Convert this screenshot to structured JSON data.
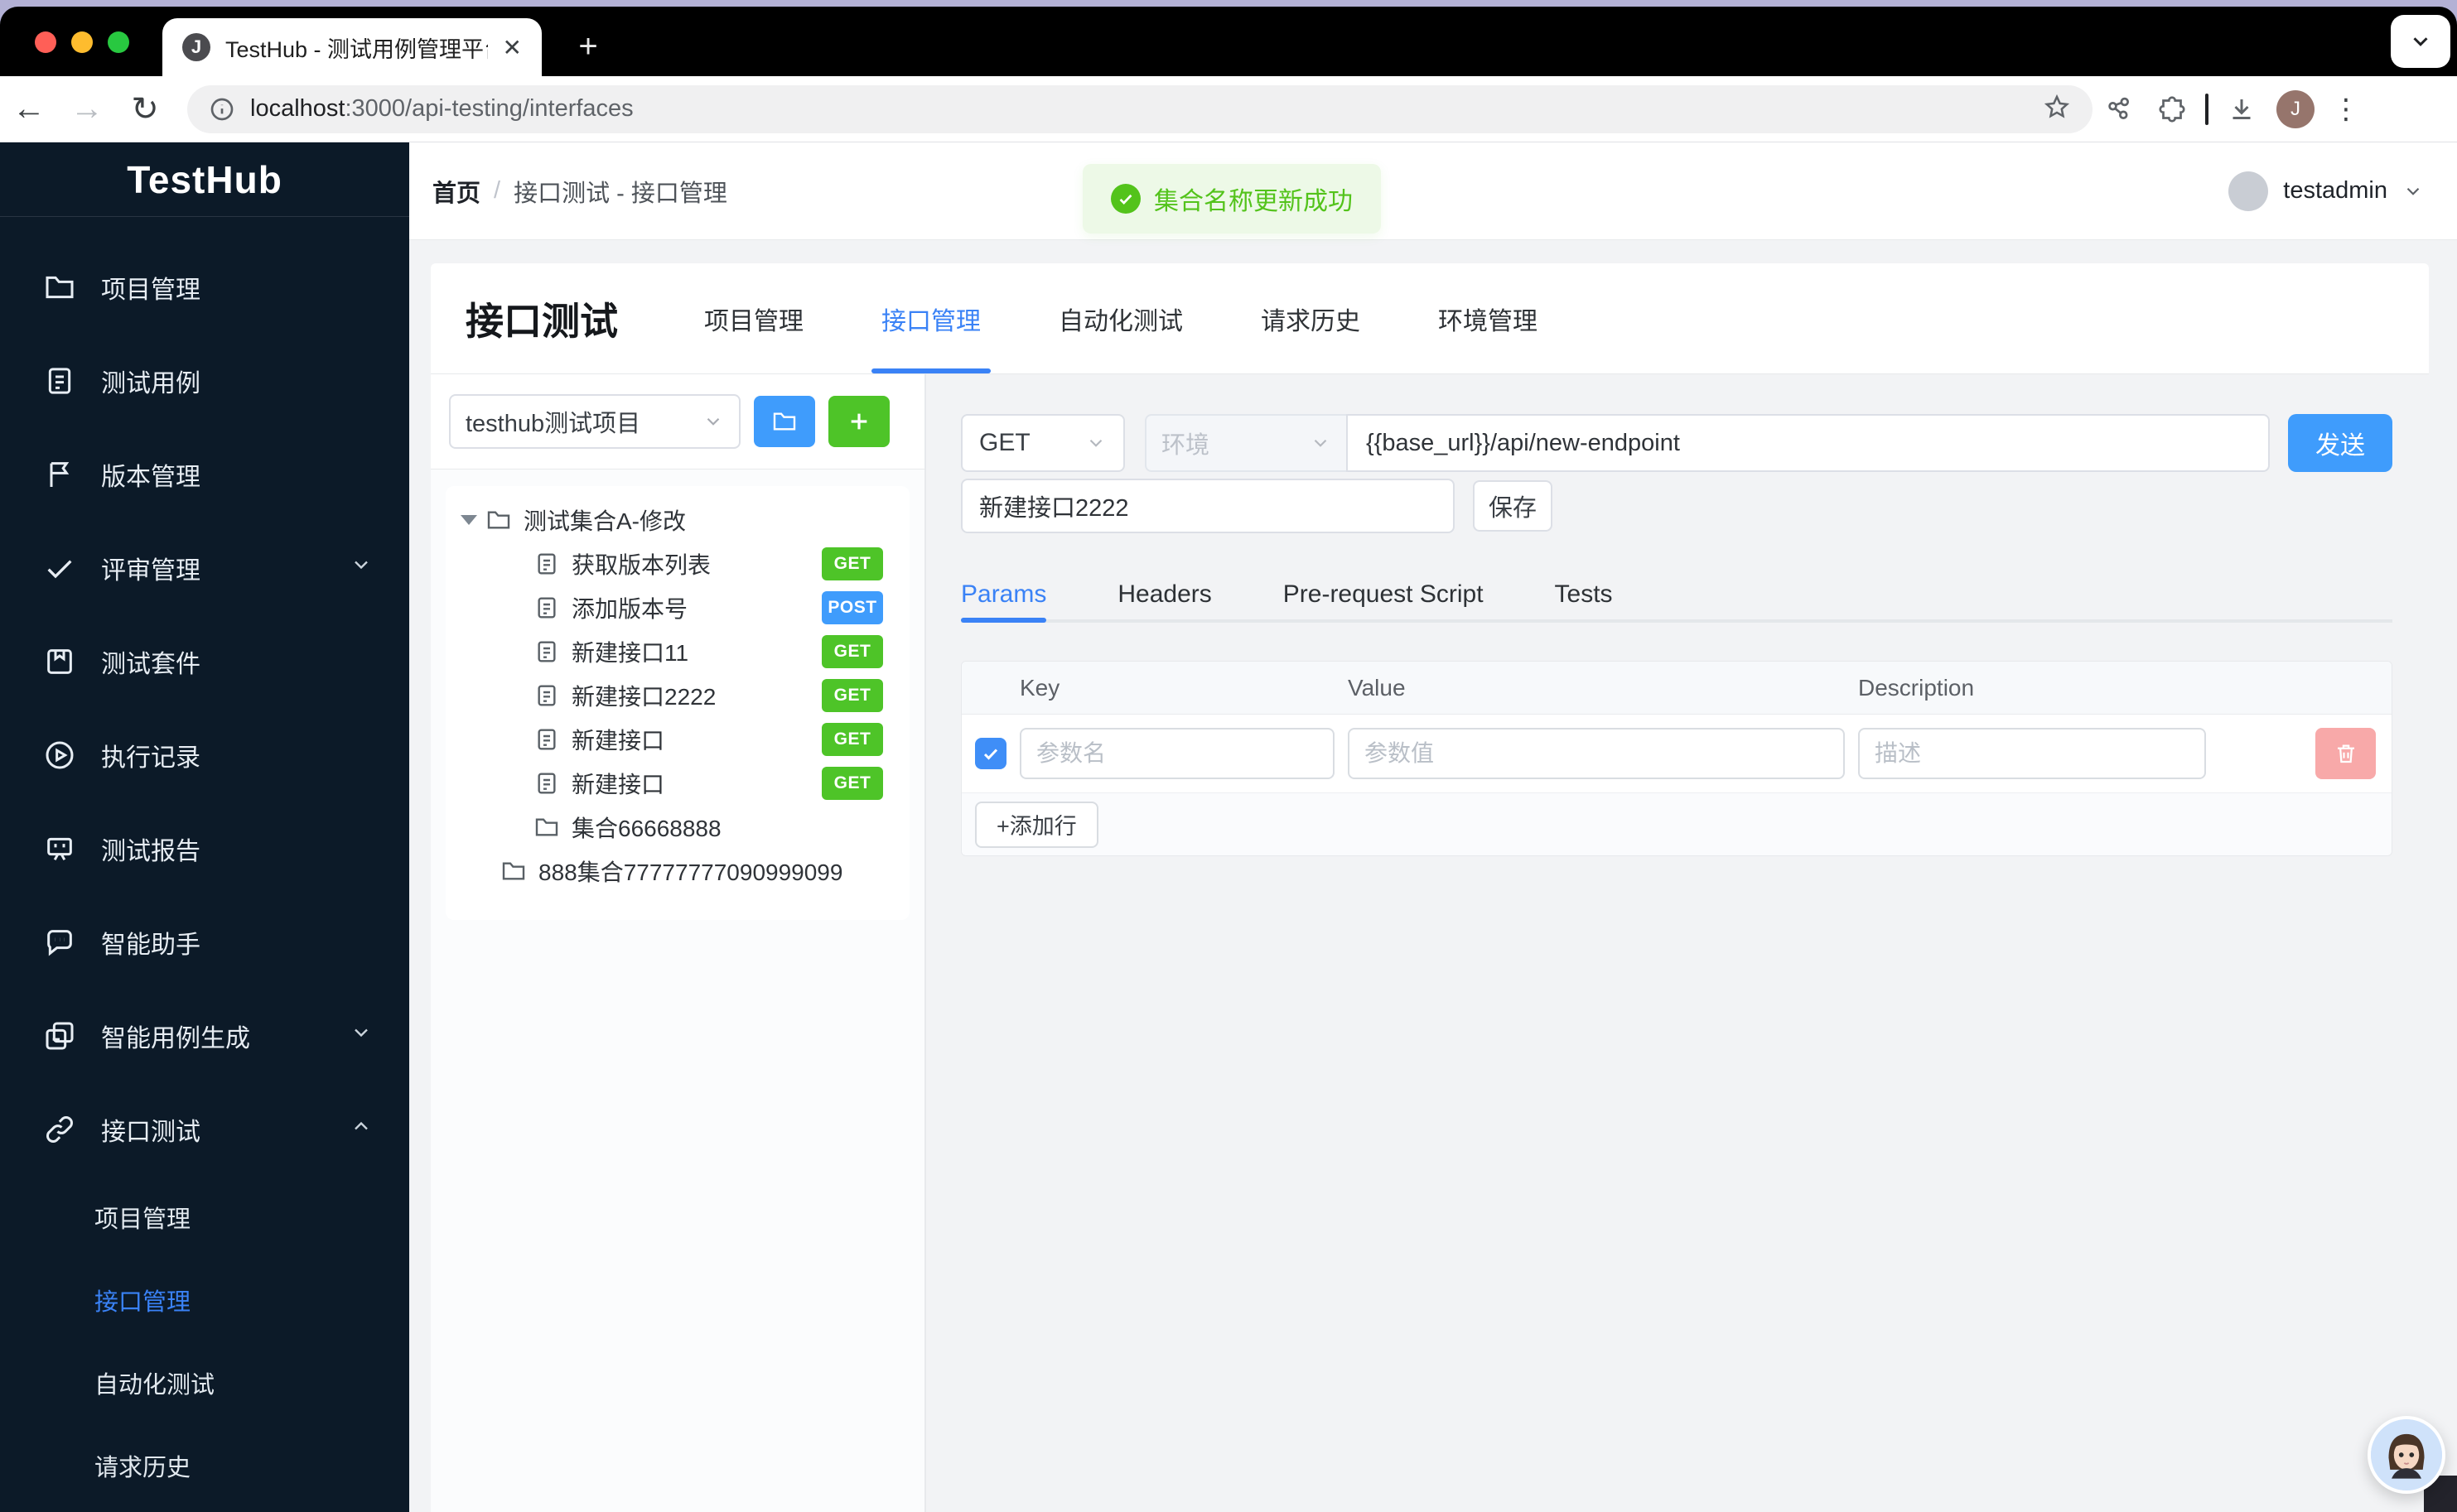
{
  "browser": {
    "tab_title": "TestHub - 测试用例管理平台",
    "url_host": "localhost",
    "url_path": ":3000/api-testing/interfaces",
    "profile_initial": "J"
  },
  "sidebar": {
    "logo": "TestHub",
    "items": [
      {
        "label": "项目管理",
        "icon": "folder"
      },
      {
        "label": "测试用例",
        "icon": "document"
      },
      {
        "label": "版本管理",
        "icon": "flag"
      },
      {
        "label": "评审管理",
        "icon": "check",
        "chevron": "down"
      },
      {
        "label": "测试套件",
        "icon": "suite"
      },
      {
        "label": "执行记录",
        "icon": "play-circle"
      },
      {
        "label": "测试报告",
        "icon": "report-board"
      },
      {
        "label": "智能助手",
        "icon": "chat"
      },
      {
        "label": "智能用例生成",
        "icon": "copy-docs",
        "chevron": "down"
      },
      {
        "label": "接口测试",
        "icon": "link",
        "chevron": "up"
      }
    ],
    "sub_items": [
      {
        "label": "项目管理"
      },
      {
        "label": "接口管理",
        "active": true
      },
      {
        "label": "自动化测试"
      },
      {
        "label": "请求历史"
      }
    ]
  },
  "header": {
    "breadcrumb_home": "首页",
    "breadcrumb_separator": "/",
    "breadcrumb_current": "接口测试 - 接口管理",
    "user_name": "testadmin"
  },
  "toast": {
    "message": "集合名称更新成功"
  },
  "main": {
    "title": "接口测试",
    "tabs": [
      "项目管理",
      "接口管理",
      "自动化测试",
      "请求历史",
      "环境管理"
    ],
    "active_tab": "接口管理"
  },
  "collections": {
    "project_select": "testhub测试项目",
    "tree": {
      "rows": [
        {
          "label": "测试集合A-修改",
          "type": "folder-open"
        },
        {
          "label": "获取版本列表",
          "method": "GET"
        },
        {
          "label": "添加版本号",
          "method": "POST"
        },
        {
          "label": "新建接口11",
          "method": "GET"
        },
        {
          "label": "新建接口2222",
          "method": "GET"
        },
        {
          "label": "新建接口",
          "method": "GET"
        },
        {
          "label": "新建接口",
          "method": "GET"
        },
        {
          "label": "集合66668888",
          "type": "folder"
        },
        {
          "label": "888集合77777777090999099",
          "type": "folder"
        }
      ]
    }
  },
  "request": {
    "method": "GET",
    "env_placeholder": "环境",
    "url": "{{base_url}}/api/new-endpoint",
    "send_label": "发送",
    "name_value": "新建接口2222",
    "save_label": "保存",
    "tabs": [
      "Params",
      "Headers",
      "Pre-request Script",
      "Tests"
    ],
    "active_tab": "Params",
    "params": {
      "columns": [
        "Key",
        "Value",
        "Description"
      ],
      "key_placeholder": "参数名",
      "value_placeholder": "参数值",
      "description_placeholder": "描述",
      "add_row_label": "+添加行"
    }
  },
  "colors": {
    "accent_blue": "#3f9cfc",
    "active_link_blue": "#3a82f6",
    "get_badge_green": "#4ec428",
    "post_badge_blue": "#3f9cfc",
    "toast_green": "#53c31b",
    "delete_pink": "#f8a9a9",
    "sidebar_bg": "#0c1a28"
  }
}
